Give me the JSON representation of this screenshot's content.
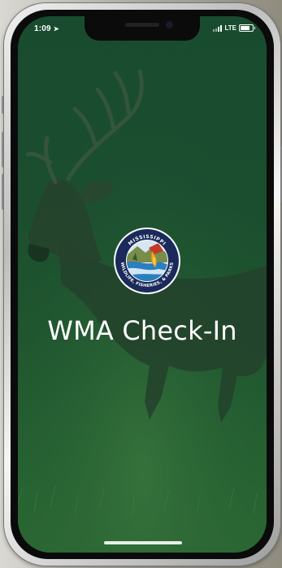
{
  "status_bar": {
    "time": "1:09",
    "network": "LTE",
    "battery_level_percent": 80
  },
  "splash": {
    "title": "WMA Check-In",
    "logo": {
      "ring_text": [
        "MISSISSIPPI",
        "WILDLIFE, FISHERIES, & PARKS"
      ],
      "ring_color": "#1a2a5a"
    }
  },
  "colors": {
    "overlay_green": "#1f4d31",
    "title_text": "#ffffff"
  },
  "icons": {
    "location": "location-arrow-icon",
    "signal": "cellular-signal-icon",
    "battery": "battery-icon"
  }
}
